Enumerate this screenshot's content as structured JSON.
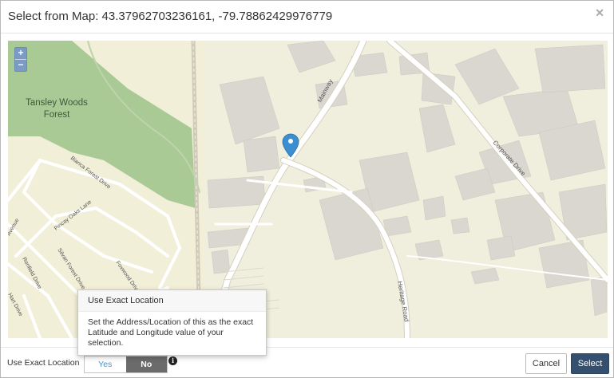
{
  "dialog": {
    "title": "Select from Map: 43.37962703236161, -79.78862429976779",
    "close_icon": "close-icon"
  },
  "map": {
    "zoom_in": "+",
    "zoom_out": "−",
    "pin_color": "#3b8fd0",
    "labels": {
      "forest_line1": "Tansley Woods",
      "forest_line2": "Forest",
      "mainway": "Mainway",
      "corporate_drive": "Corporate Drive",
      "heritage_road": "Heritage Road",
      "bianca": "Bianca Forest Drive",
      "pincay": "Pincay Oaks Lane",
      "foxwood": "Foxwood Drive",
      "silvan": "Silvan Forest Drive",
      "renfield": "Renfield Drive",
      "avenue": "Avenue",
      "hart": "Hart Drive"
    }
  },
  "tooltip": {
    "title": "Use Exact Location",
    "body": "Set the Address/Location of this as the exact Latitude and Longitude value of your selection."
  },
  "footer": {
    "label": "Use Exact Location",
    "yes": "Yes",
    "no": "No",
    "selected": "No",
    "info_icon": "info-icon",
    "cancel": "Cancel",
    "select": "Select"
  }
}
